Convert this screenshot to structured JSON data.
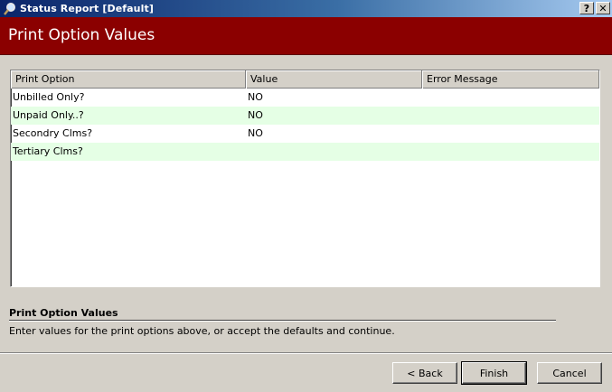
{
  "window": {
    "title": "Status Report [Default]",
    "help_label": "?",
    "close_label": "✕"
  },
  "header": {
    "title": "Print Option Values"
  },
  "grid": {
    "columns": [
      "Print Option",
      "Value",
      "Error Message"
    ],
    "rows": [
      {
        "option": "Unbilled Only?",
        "value": "NO",
        "error": ""
      },
      {
        "option": "Unpaid Only..?",
        "value": "NO",
        "error": ""
      },
      {
        "option": "Secondry Clms?",
        "value": "NO",
        "error": ""
      },
      {
        "option": "Tertiary Clms?",
        "value": "",
        "error": ""
      }
    ]
  },
  "description": {
    "title": "Print Option Values",
    "text": "Enter values for the print options above, or accept the defaults and continue."
  },
  "buttons": {
    "back": "< Back",
    "finish": "Finish",
    "cancel": "Cancel"
  },
  "colors": {
    "header_bg": "#8b0000",
    "alt_row": "#e5ffe5",
    "titlebar_start": "#0a246a"
  }
}
